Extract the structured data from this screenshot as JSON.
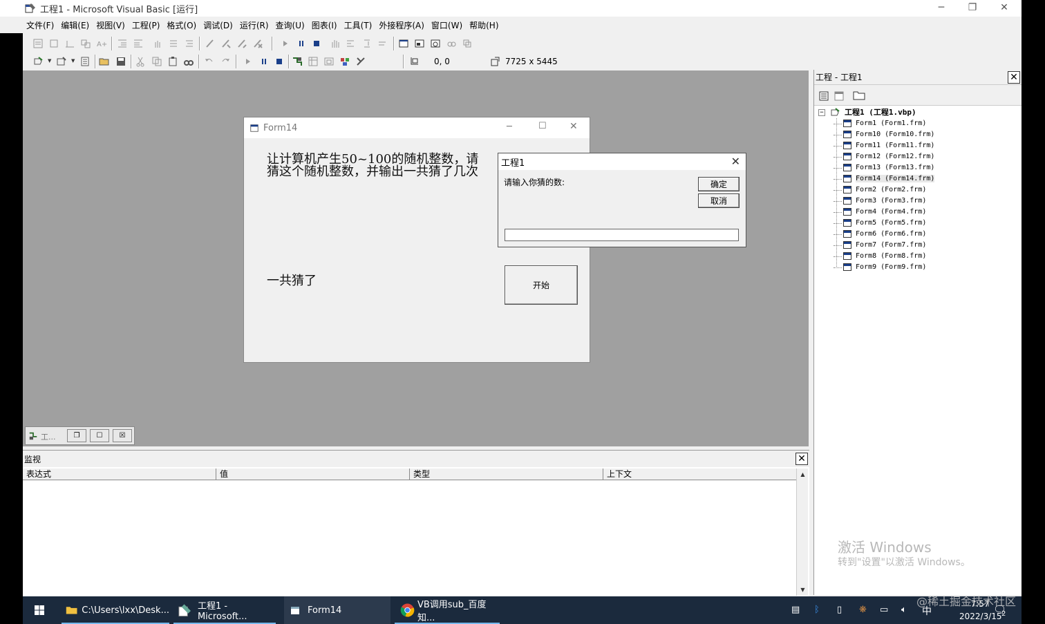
{
  "window": {
    "title": "工程1 - Microsoft Visual Basic [运行]",
    "minimize": "─",
    "restore": "❐",
    "close": "✕"
  },
  "menu": [
    "文件(F)",
    "编辑(E)",
    "视图(V)",
    "工程(P)",
    "格式(O)",
    "调试(D)",
    "运行(R)",
    "查询(U)",
    "图表(I)",
    "工具(T)",
    "外接程序(A)",
    "窗口(W)",
    "帮助(H)"
  ],
  "toolbar": {
    "position": "0, 0",
    "size": "7725 x 5445"
  },
  "form14": {
    "title": "Form14",
    "prompt_label": "让计算机产生50~100的随机整数，请猜这个随机整数，并输出一共猜了几次",
    "count_label": "一共猜了",
    "start_button": "开始"
  },
  "input_dialog": {
    "title": "工程1",
    "prompt": "请输入你猜的数:",
    "ok_button": "确定",
    "cancel_button": "取消",
    "value": ""
  },
  "minimized_window": {
    "label": "工..."
  },
  "project_panel": {
    "title": "工程 - 工程1",
    "root": "工程1 (工程1.vbp)",
    "items": [
      "Form1 (Form1.frm)",
      "Form10 (Form10.frm)",
      "Form11 (Form11.frm)",
      "Form12 (Form12.frm)",
      "Form13 (Form13.frm)",
      "Form14 (Form14.frm)",
      "Form2 (Form2.frm)",
      "Form3 (Form3.frm)",
      "Form4 (Form4.frm)",
      "Form5 (Form5.frm)",
      "Form6 (Form6.frm)",
      "Form7 (Form7.frm)",
      "Form8 (Form8.frm)",
      "Form9 (Form9.frm)"
    ],
    "selected_index": 5
  },
  "activation": {
    "line1": "激活 Windows",
    "line2": "转到\"设置\"以激活 Windows。"
  },
  "watermark": "@稀土掘金技术社区",
  "watch_panel": {
    "title": "监视",
    "columns": [
      "表达式",
      "值",
      "类型",
      "上下文"
    ]
  },
  "taskbar": {
    "items": [
      {
        "label": "C:\\Users\\lxx\\Desk...",
        "icon": "folder-icon"
      },
      {
        "label": "工程1 - Microsoft...",
        "icon": "vb-icon"
      },
      {
        "label": "Form14",
        "icon": "form-icon"
      },
      {
        "label": "VB调用sub_百度知...",
        "icon": "chrome-icon"
      }
    ],
    "ime": "中",
    "time": "7:57",
    "date": "2022/3/15",
    "notifications": "2"
  }
}
